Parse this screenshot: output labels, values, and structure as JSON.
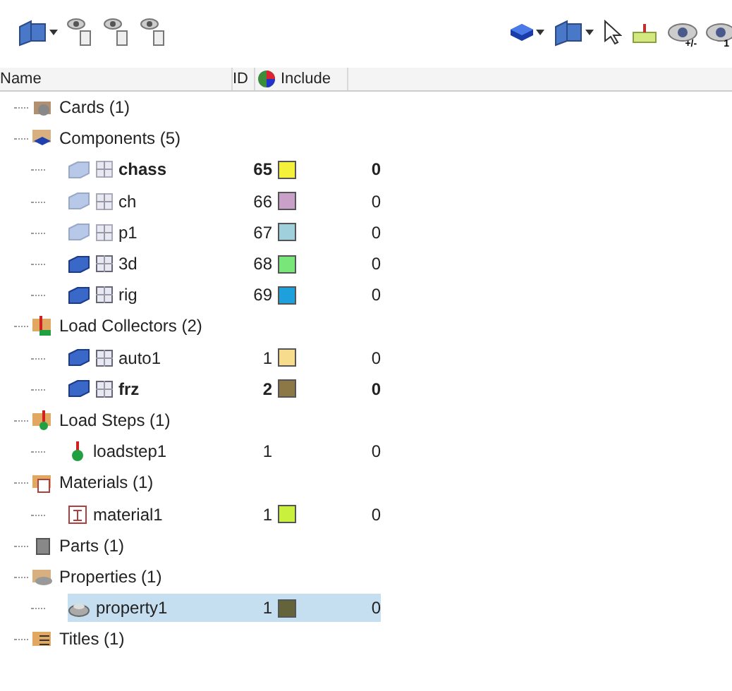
{
  "toolbar": {
    "left": [
      {
        "kind": "layers",
        "caret": true
      },
      {
        "kind": "eye-grid"
      },
      {
        "kind": "eye-grid"
      },
      {
        "kind": "eye-grid"
      }
    ],
    "right": [
      {
        "kind": "cube",
        "caret": true
      },
      {
        "kind": "layers",
        "caret": true
      },
      {
        "kind": "cursor"
      },
      {
        "kind": "load"
      },
      {
        "kind": "eye",
        "badge": "+/-"
      },
      {
        "kind": "eye",
        "badge": "1"
      }
    ]
  },
  "columns": [
    "Name",
    "ID",
    "Include"
  ],
  "tree": [
    {
      "kind": "cards",
      "label": "Cards (1)"
    },
    {
      "kind": "components",
      "label": "Components (5)",
      "children": [
        {
          "kind": "component",
          "name": "chass",
          "id": "65",
          "color": "#f4f03c",
          "include": "0",
          "current": true,
          "shown": false,
          "selected": false
        },
        {
          "kind": "component",
          "name": "ch",
          "id": "66",
          "color": "#c8a0c8",
          "include": "0",
          "current": false,
          "shown": false,
          "selected": false
        },
        {
          "kind": "component",
          "name": "p1",
          "id": "67",
          "color": "#a0d0dc",
          "include": "0",
          "current": false,
          "shown": false,
          "selected": false
        },
        {
          "kind": "component",
          "name": "3d",
          "id": "68",
          "color": "#78e678",
          "include": "0",
          "current": false,
          "shown": true,
          "selected": false
        },
        {
          "kind": "component",
          "name": "rig",
          "id": "69",
          "color": "#1ea0dc",
          "include": "0",
          "current": false,
          "shown": true,
          "selected": false
        }
      ]
    },
    {
      "kind": "load_collectors",
      "label": "Load Collectors (2)",
      "children": [
        {
          "kind": "component",
          "name": "auto1",
          "id": "1",
          "color": "#f6dc8c",
          "include": "0",
          "current": false,
          "shown": true,
          "selected": false
        },
        {
          "kind": "component",
          "name": "frz",
          "id": "2",
          "color": "#8c7846",
          "include": "0",
          "current": true,
          "shown": true,
          "selected": false
        }
      ]
    },
    {
      "kind": "load_steps",
      "label": "Load Steps (1)",
      "children": [
        {
          "kind": "loadstep",
          "name": "loadstep1",
          "id": "1",
          "include": "0",
          "current": false,
          "selected": false
        }
      ]
    },
    {
      "kind": "materials",
      "label": "Materials (1)",
      "children": [
        {
          "kind": "material",
          "name": "material1",
          "id": "1",
          "color": "#c8f03c",
          "include": "0",
          "current": false,
          "selected": false
        }
      ]
    },
    {
      "kind": "parts",
      "label": "Parts (1)"
    },
    {
      "kind": "properties",
      "label": "Properties (1)",
      "children": [
        {
          "kind": "property",
          "name": "property1",
          "id": "1",
          "color": "#64643c",
          "include": "0",
          "current": false,
          "selected": true
        }
      ]
    },
    {
      "kind": "titles",
      "label": "Titles (1)"
    }
  ]
}
